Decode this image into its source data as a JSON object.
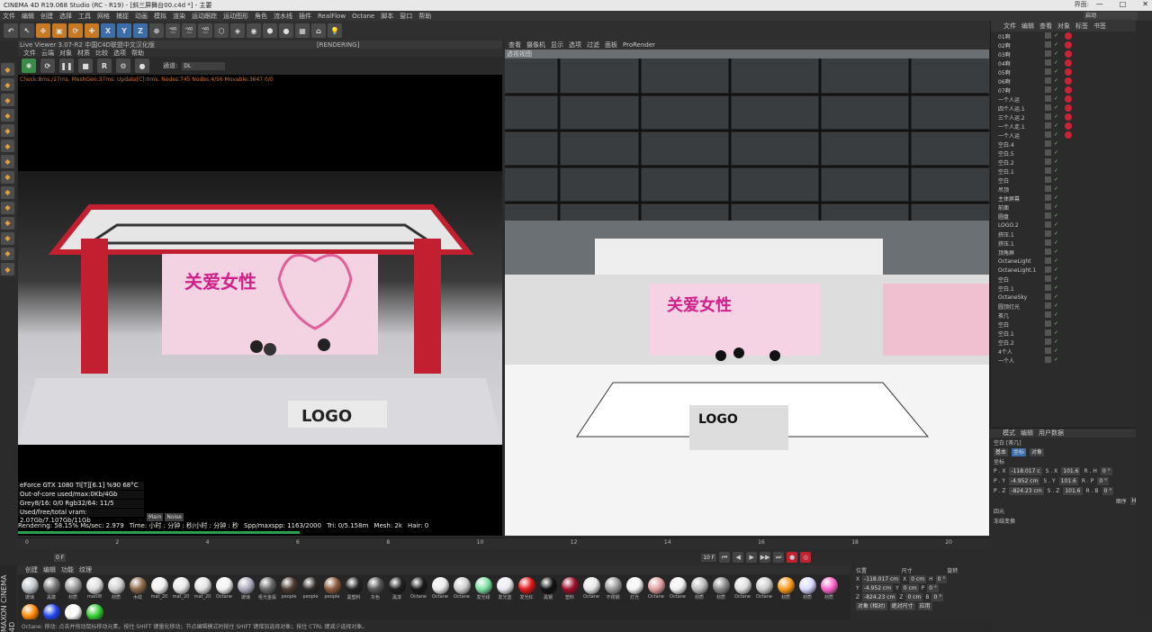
{
  "window": {
    "title": "CINEMA 4D R19.068 Studio (RC - R19) - [斜三屏舞台00.c4d *] - 主要",
    "layout_label": "界面:",
    "layout_value": "启动",
    "controls": [
      "—",
      "□",
      "✕"
    ]
  },
  "menu": [
    "文件",
    "编辑",
    "创建",
    "选择",
    "工具",
    "网格",
    "捕捉",
    "动画",
    "模拟",
    "渲染",
    "运动跟踪",
    "运动图形",
    "角色",
    "流水线",
    "插件",
    "RealFlow",
    "Octane",
    "脚本",
    "窗口",
    "帮助"
  ],
  "toolbar": {
    "buttons": [
      "↶",
      "↖",
      "✥",
      "▣",
      "⟳",
      "✚",
      "X",
      "Y",
      "Z",
      "⊕",
      "🎬",
      "🎬",
      "🎬",
      "⬡",
      "◈",
      "◉",
      "⬢",
      "●",
      "▦",
      "⌂",
      "💡"
    ]
  },
  "live_viewer": {
    "title": "Live Viewer 3.07-R2 中国C4D联盟中文汉化版",
    "status": "[RENDERING]",
    "menu": [
      "文件",
      "云端",
      "对象",
      "材质",
      "比较",
      "选项",
      "帮助"
    ],
    "channel_label": "通道:",
    "channel_value": "DL",
    "stats": "Check:8ms./27ms. MeshGen:37ms. Update[C]:0ms. Nodes:745 Nodes:4/56 Movable:3647  0/0"
  },
  "gpu": {
    "lines": [
      "eForce GTX 1080 Ti[T][6.1]   %90      68°C",
      "Out-of-core used/max:0Kb/4Gb",
      "Grey8/16: 0/0          Rgb32/64: 11/5",
      "Used/free/total vram: 2.07Gb/7.107Gb/11Gb"
    ],
    "main_btn": "Main",
    "noise_btn": "Noise"
  },
  "render_status": {
    "rendering": "Rendering: 58.15% Ms/sec: 2.979",
    "time": "Time: 小时 : 分钟 : 秒/小时 : 分钟 : 秒",
    "spp": "Spp/maxspp: 1163/2000",
    "tri": "Tri: 0/5.158m",
    "mesh": "Mesh: 2k",
    "hair": "Hair: 0",
    "progress_fraction": 0.58
  },
  "stage": {
    "banner_title": "关爱女性",
    "logo": "LOGO"
  },
  "viewport": {
    "menu": [
      "查看",
      "摄像机",
      "显示",
      "选项",
      "过滤",
      "面板",
      "ProRender"
    ],
    "label": "透视视图"
  },
  "object_manager": {
    "tabs": [
      "文件",
      "编辑",
      "查看",
      "对象",
      "标签",
      "书签"
    ],
    "objects": [
      "01啊",
      "02啊",
      "03啊",
      "04啊",
      "05啊",
      "06啊",
      "07啊",
      "一个人运",
      "四个人运.1",
      "三个人运.2",
      "一个人走.1",
      "一个人运",
      "空白.4",
      "空白.5",
      "空白.2",
      "空白.1",
      "空白",
      "吊顶",
      "主体屏幕",
      "前面",
      "圆盘",
      "LOGO.2",
      "挤压.1",
      "挤压.1",
      "顶角屏",
      "OctaneLight",
      "OctaneLight.1",
      "空白",
      "空白.1",
      "OctaneSky",
      "圆顶灯光",
      "茶几",
      "空白",
      "空白.1",
      "空白.2",
      "4个人",
      "一个人"
    ]
  },
  "attributes": {
    "tabs": [
      "模式",
      "编辑",
      "用户数据"
    ],
    "object_label": "空白 [茶几]",
    "subtabs": [
      "基本",
      "坐标",
      "对象"
    ],
    "section": "坐标",
    "rows": [
      {
        "p": "P . X",
        "pv": "-118.017 c",
        "s": "S . X",
        "sv": "101.6",
        "r": "R . H",
        "rv": "0 °"
      },
      {
        "p": "P . Y",
        "pv": "-4.952 cm",
        "s": "S . Y",
        "sv": "101.6",
        "r": "R . P",
        "rv": "0 °"
      },
      {
        "p": "P . Z",
        "pv": "-824.23 cm",
        "s": "S . Z",
        "sv": "101.6",
        "r": "R . B",
        "rv": "0 °"
      }
    ],
    "order_label": "顺序",
    "order_value": "HPB",
    "groups": [
      "四元",
      "冻结变换"
    ]
  },
  "timeline": {
    "ticks": [
      "0",
      "2",
      "4",
      "6",
      "8",
      "10",
      "12",
      "14",
      "16",
      "18",
      "20"
    ],
    "start": "0 F",
    "end": "10 F",
    "current": "10 F",
    "right": "0 F"
  },
  "materials": {
    "menu": [
      "创建",
      "编辑",
      "功能",
      "纹理"
    ],
    "items": [
      {
        "n": "玻璃",
        "c": "#bfc6cc"
      },
      {
        "n": "黑膜",
        "c": "#777"
      },
      {
        "n": "材质",
        "c": "#999"
      },
      {
        "n": "mat08",
        "c": "#ddd"
      },
      {
        "n": "材质",
        "c": "#cfcfcf"
      },
      {
        "n": "木纹",
        "c": "#8a6a48"
      },
      {
        "n": "mat_20",
        "c": "#eee"
      },
      {
        "n": "mat_20",
        "c": "#e8e8e8"
      },
      {
        "n": "mat_20",
        "c": "#e0e0e0"
      },
      {
        "n": "Octane",
        "c": "#f2f2f2"
      },
      {
        "n": "玻璃",
        "c": "#aab"
      },
      {
        "n": "哑光金属",
        "c": "#666"
      },
      {
        "n": "people",
        "c": "#4a3a32"
      },
      {
        "n": "people",
        "c": "#2e2a28"
      },
      {
        "n": "people",
        "c": "#8a5a3c"
      },
      {
        "n": "黑塑料",
        "c": "#222"
      },
      {
        "n": "灰色",
        "c": "#555"
      },
      {
        "n": "黑漆",
        "c": "#1e1e1e"
      },
      {
        "n": "Octane",
        "c": "#181818"
      },
      {
        "n": "Octane",
        "c": "#eaeaea"
      },
      {
        "n": "Octane",
        "c": "#cfcfcf"
      },
      {
        "n": "发光绿",
        "c": "#7be0a0"
      },
      {
        "n": "发光蓝",
        "c": "#e8e8f0"
      },
      {
        "n": "发光红",
        "c": "#e01a1a"
      },
      {
        "n": "黑钢",
        "c": "#111"
      },
      {
        "n": "塑料",
        "c": "#a0102a"
      },
      {
        "n": "Octane",
        "c": "#e6e6e6"
      },
      {
        "n": "不锈钢",
        "c": "#9a9a9a"
      },
      {
        "n": "灯光",
        "c": "#f4f4f4"
      },
      {
        "n": "Octane",
        "c": "#e0a0a0"
      },
      {
        "n": "Octane",
        "c": "#f0f0f0"
      },
      {
        "n": "材质",
        "c": "#bbb"
      },
      {
        "n": "材质",
        "c": "#888"
      },
      {
        "n": "Octane",
        "c": "#ddd"
      },
      {
        "n": "Octane",
        "c": "#ccc"
      },
      {
        "n": "材质",
        "c": "#ff9a1a"
      },
      {
        "n": "材质",
        "c": "#d8d8ff"
      },
      {
        "n": "材质",
        "c": "#ff66cc"
      },
      {
        "n": "材质",
        "c": "#ff8800"
      },
      {
        "n": "材质",
        "c": "#2244ee"
      },
      {
        "n": "材质",
        "c": "#ffffff"
      },
      {
        "n": "材质",
        "c": "#33cc33"
      }
    ]
  },
  "coords": {
    "headers": [
      "位置",
      "尺寸",
      "旋转"
    ],
    "rows": [
      [
        "X",
        "-118.017 cm",
        "X",
        "0 cm",
        "H",
        "0 °"
      ],
      [
        "Y",
        "-4.952 cm",
        "Y",
        "0 cm",
        "P",
        "0 °"
      ],
      [
        "Z",
        "-824.23 cm",
        "Z",
        "0 cm",
        "B",
        "0 °"
      ]
    ],
    "mode": "对象 (相对)",
    "size_mode": "绝对尺寸",
    "apply": "应用"
  },
  "status": {
    "text": "Octane:          移动: 点击并拖动鼠标移动元素。按住 SHIFT 键量化移动；节点编辑模式时按住 SHIFT 键增加选择对象；按住 CTRL 键减少选择对象。"
  },
  "brand": {
    "maxon": "MAXON CINEMA 4D"
  },
  "colors": {
    "accent": "#3b6ea8",
    "red": "#c22030",
    "progress": "#29a24a"
  }
}
